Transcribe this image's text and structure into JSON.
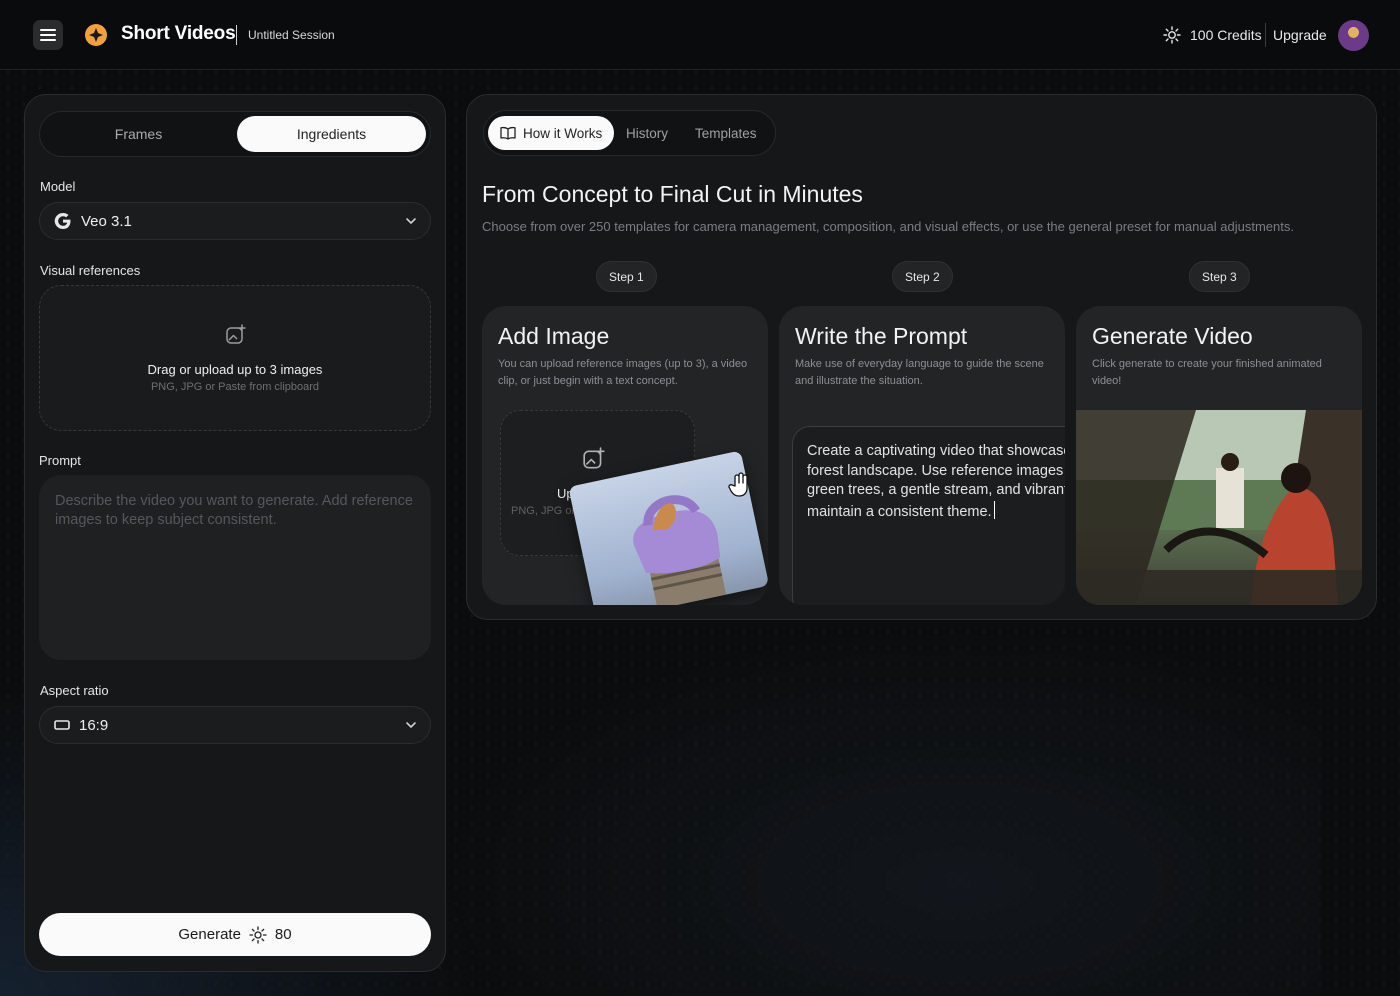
{
  "header": {
    "app_title": "Short Videos",
    "session": "Untitled Session",
    "credits": "100 Credits",
    "upgrade": "Upgrade",
    "icons": {
      "menu": "menu-icon",
      "logo": "logo-icon",
      "credits": "sparkle-icon"
    }
  },
  "left_panel": {
    "tabs": [
      "Frames",
      "Ingredients"
    ],
    "active_tab": "Ingredients",
    "model_label": "Model",
    "model_value": "Veo 3.1",
    "visual_refs_label": "Visual references",
    "dropzone_title": "Drag or upload up to 3 images",
    "dropzone_sub": "PNG, JPG or Paste from clipboard",
    "prompt_label": "Prompt",
    "prompt_placeholder": "Describe the video you want to generate. Add reference images to keep subject consistent.",
    "aspect_label": "Aspect ratio",
    "aspect_value": "16:9",
    "generate_label": "Generate",
    "generate_cost": "80"
  },
  "right_panel": {
    "tabs": [
      "How it Works",
      "History",
      "Templates"
    ],
    "active_tab": "How it Works",
    "title": "From Concept to Final Cut in Minutes",
    "subtitle": "Choose from over 250 templates for camera management, composition, and visual effects, or use the general preset for manual adjustments.",
    "steps": [
      {
        "pill": "Step 1",
        "title": "Add Image",
        "desc": "You can upload reference images (up to 3), a video clip, or just begin with a text concept.",
        "upload_title": "Upload Image",
        "upload_sub": "PNG, JPG or Paste from clipboard"
      },
      {
        "pill": "Step 2",
        "title": "Write the Prompt",
        "desc": "Make use of everyday language to guide the scene and illustrate the situation.",
        "prompt_lines": [
          "Create a captivating video that showcases a",
          "forest landscape. Use reference images of",
          "green trees, a gentle stream, and vibrant",
          "maintain a consistent theme."
        ]
      },
      {
        "pill": "Step 3",
        "title": "Generate Video",
        "desc": "Click generate to create your finished animated video!"
      }
    ]
  }
}
